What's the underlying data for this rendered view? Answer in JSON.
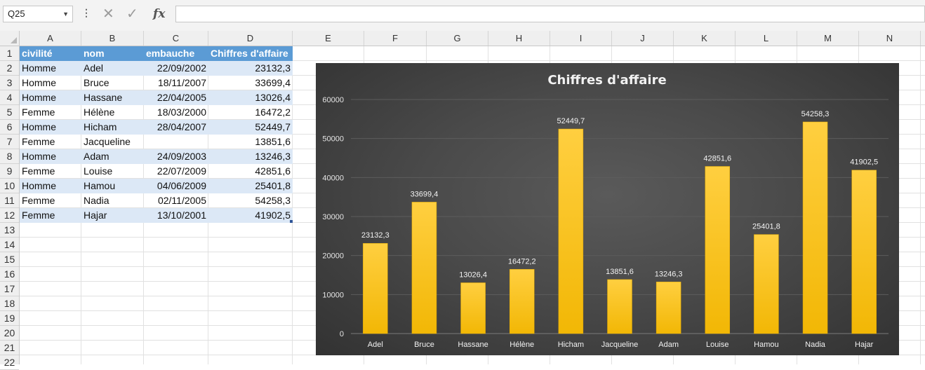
{
  "formula_bar": {
    "name_box": "Q25",
    "formula": ""
  },
  "columns": [
    "A",
    "B",
    "C",
    "D",
    "E",
    "F",
    "G",
    "H",
    "I",
    "J",
    "K",
    "L",
    "M",
    "N"
  ],
  "rows": [
    "1",
    "2",
    "3",
    "4",
    "5",
    "6",
    "7",
    "8",
    "9",
    "10",
    "11",
    "12",
    "13",
    "14",
    "15",
    "16",
    "17",
    "18",
    "19",
    "20",
    "21",
    "22"
  ],
  "table": {
    "headers": [
      "civilité",
      "nom",
      "embauche",
      "Chiffres d'affaire"
    ],
    "records": [
      [
        "Homme",
        "Adel",
        "22/09/2002",
        "23132,3"
      ],
      [
        "Homme",
        "Bruce",
        "18/11/2007",
        "33699,4"
      ],
      [
        "Homme",
        "Hassane",
        "22/04/2005",
        "13026,4"
      ],
      [
        "Femme",
        "Hélène",
        "18/03/2000",
        "16472,2"
      ],
      [
        "Homme",
        "Hicham",
        "28/04/2007",
        "52449,7"
      ],
      [
        "Femme",
        "Jacqueline",
        "",
        "13851,6"
      ],
      [
        "Homme",
        "Adam",
        "24/09/2003",
        "13246,3"
      ],
      [
        "Femme",
        "Louise",
        "22/07/2009",
        "42851,6"
      ],
      [
        "Homme",
        "Hamou",
        "04/06/2009",
        "25401,8"
      ],
      [
        "Femme",
        "Nadia",
        "02/11/2005",
        "54258,3"
      ],
      [
        "Femme",
        "Hajar",
        "13/10/2001",
        "41902,5"
      ]
    ]
  },
  "chart_data": {
    "type": "bar",
    "title": "Chiffres d'affaire",
    "categories": [
      "Adel",
      "Bruce",
      "Hassane",
      "Hélène",
      "Hicham",
      "Jacqueline",
      "Adam",
      "Louise",
      "Hamou",
      "Nadia",
      "Hajar"
    ],
    "series": [
      {
        "values": [
          23132.3,
          33699.4,
          13026.4,
          16472.2,
          52449.7,
          13851.6,
          13246.3,
          42851.6,
          25401.8,
          54258.3,
          41902.5
        ]
      }
    ],
    "data_labels": [
      "23132,3",
      "33699,4",
      "13026,4",
      "16472,2",
      "52449,7",
      "13851,6",
      "13246,3",
      "42851,6",
      "25401,8",
      "54258,3",
      "41902,5"
    ],
    "y_ticks": [
      0,
      10000,
      20000,
      30000,
      40000,
      50000,
      60000
    ],
    "ylim": [
      0,
      60000
    ],
    "grid": true,
    "legend": "none",
    "colors": {
      "bar_top": "#ffd34e",
      "bar_bottom": "#f2b705",
      "background": "#404040",
      "text": "#ffffff",
      "title": "#f2f2f2"
    }
  }
}
